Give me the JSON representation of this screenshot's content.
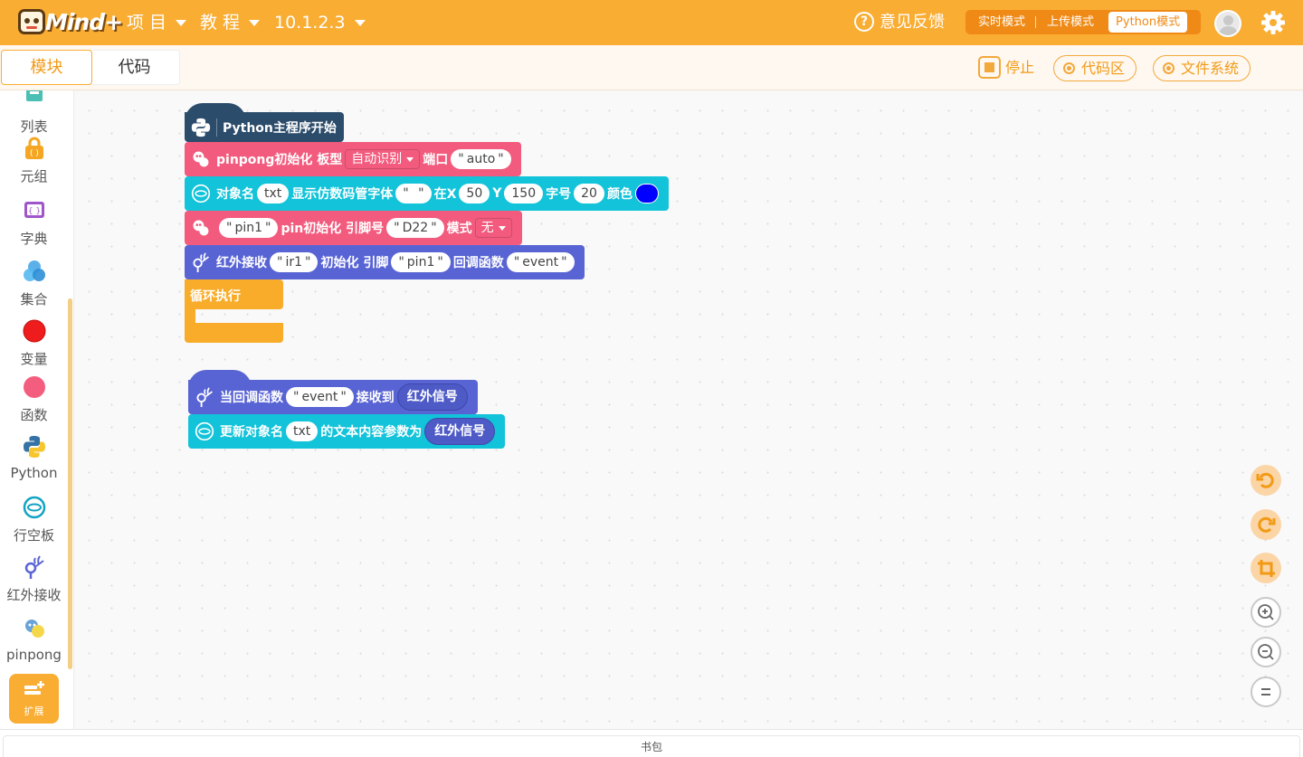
{
  "app": {
    "logo_text": "Mind+"
  },
  "topbar": {
    "menu": [
      {
        "label": "项 目"
      },
      {
        "label": "教 程"
      },
      {
        "label": "10.1.2.3"
      }
    ],
    "feedback": "意见反馈",
    "modes": [
      "实时模式",
      "上传模式",
      "Python模式"
    ],
    "active_mode": "Python模式"
  },
  "subbar": {
    "tabs": [
      "模块",
      "代码"
    ],
    "active_tab": "模块",
    "stop": "停止",
    "code_area": "代码区",
    "file_system": "文件系统"
  },
  "sidebar": {
    "categories": [
      {
        "label": "列表",
        "icon": "list-icon",
        "color": "#4cbfb4"
      },
      {
        "label": "元组",
        "icon": "tuple-icon",
        "color": "#f5a623"
      },
      {
        "label": "字典",
        "icon": "dict-icon",
        "color": "#a055c9"
      },
      {
        "label": "集合",
        "icon": "set-icon",
        "color": "#4aa7e8"
      },
      {
        "label": "变量",
        "icon": "variable-icon",
        "color": "#ee1c1c"
      },
      {
        "label": "函数",
        "icon": "function-icon",
        "color": "#f45e7e"
      },
      {
        "label": "Python",
        "icon": "python-icon",
        "color": "#3572a5"
      },
      {
        "label": "行空板",
        "icon": "unihiker-icon",
        "color": "#13a3c4"
      },
      {
        "label": "红外接收",
        "icon": "ir-receiver-icon",
        "color": "#5964d4"
      },
      {
        "label": "pinpong",
        "icon": "pinpong-icon",
        "color": "#6aa3d8"
      }
    ],
    "extension": "扩展"
  },
  "blocks": {
    "main_hat": "Python主程序开始",
    "pinpong_init": {
      "text": "pinpong初始化 板型",
      "board": "自动识别",
      "port_label": "端口",
      "port": "auto"
    },
    "display": {
      "label_obj": "对象名",
      "obj": "txt",
      "label_show": "显示仿数码管字体",
      "text": " ",
      "label_x": "在X",
      "x": "50",
      "label_y": "Y",
      "y": "150",
      "label_size": "字号",
      "size": "20",
      "label_color": "颜色",
      "color": "#0000ff"
    },
    "pin_init": {
      "pin": "pin1",
      "label": "pin初始化 引脚号",
      "pin_no": "D22",
      "mode_label": "模式",
      "mode": "无"
    },
    "ir_init": {
      "label": "红外接收",
      "name": "ir1",
      "label2": "初始化 引脚",
      "pin": "pin1",
      "label3": "回调函数",
      "callback": "event"
    },
    "loop": "循环执行",
    "callback_hat": {
      "label": "当回调函数",
      "callback": "event",
      "label2": "接收到",
      "var": "红外信号"
    },
    "update": {
      "label": "更新对象名",
      "obj": "txt",
      "label2": "的文本内容参数为",
      "var": "红外信号"
    }
  },
  "bottombar": {
    "label": "书包"
  }
}
